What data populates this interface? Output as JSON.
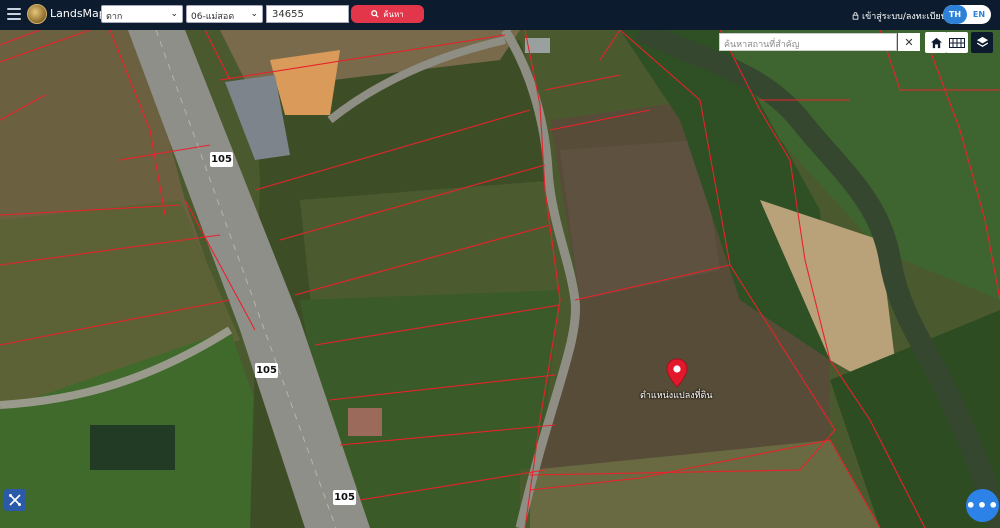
{
  "header": {
    "brand": "LandsMaps",
    "province_select": "ตาก",
    "district_select": "06-แม่สอด",
    "parcel_number": "34655",
    "search_button": "ค้นหา",
    "login_link": "เข้าสู่ระบบ/ลงทะเบียน",
    "lang_th": "TH",
    "lang_en": "EN"
  },
  "map": {
    "place_search_placeholder": "ค้นหาสถานที่สำคัญ",
    "clear_label": "✕",
    "marker_label": "ตำแหน่งแปลงที่ดิน",
    "route_shields": [
      "105",
      "105",
      "105"
    ],
    "more_button": "•••"
  },
  "colors": {
    "header_bg": "#0d1b2e",
    "search_button": "#e3364a",
    "parcel_lines": "#e8222a",
    "marker": "#e2192c",
    "fab": "#2d82e8"
  },
  "icons": [
    "hamburger-icon",
    "search-icon",
    "lock-icon",
    "home-icon",
    "grid-icon",
    "layers-icon",
    "tools-icon",
    "map-pin-icon"
  ]
}
